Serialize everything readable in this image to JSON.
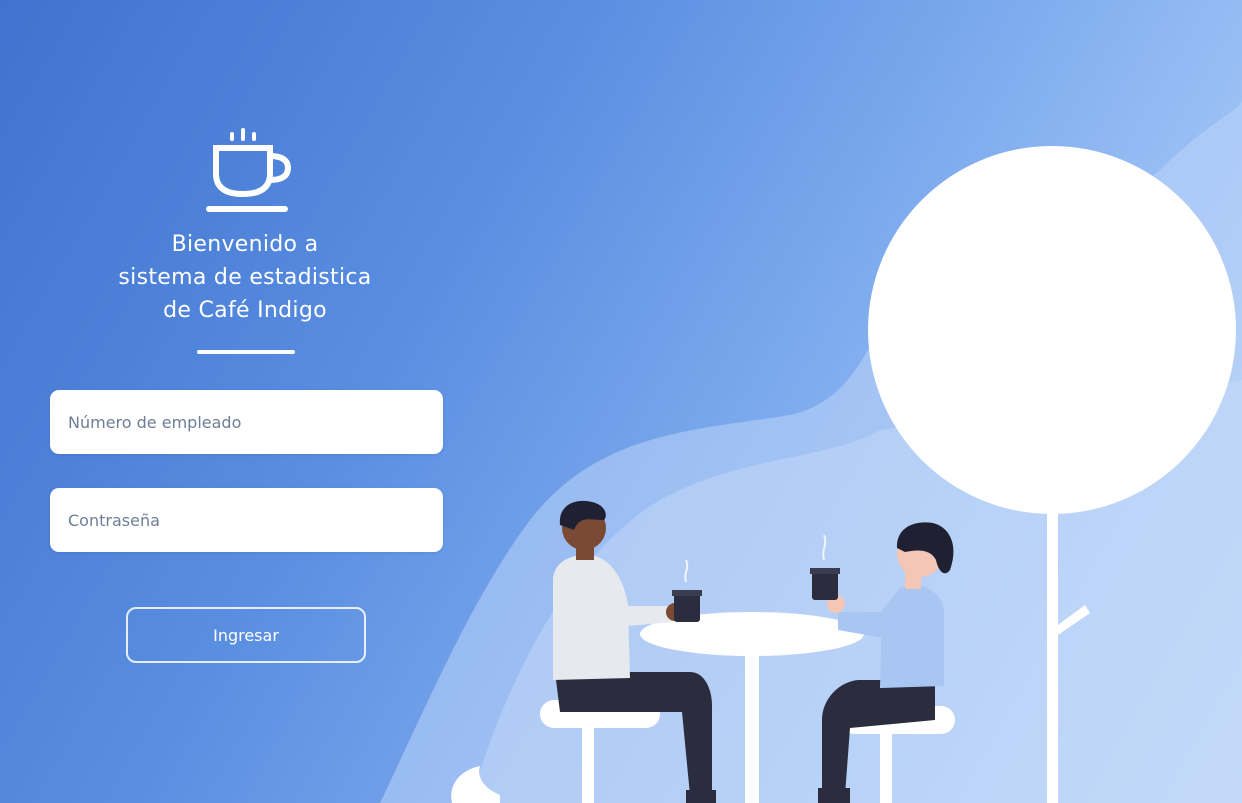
{
  "welcome": {
    "line1": "Bienvenido a",
    "line2": "sistema de estadistica",
    "line3": "de Café Indigo"
  },
  "form": {
    "employee_placeholder": "Número de empleado",
    "employee_value": "",
    "password_placeholder": "Contraseña",
    "password_value": "",
    "submit_label": "Ingresar"
  },
  "icons": {
    "logo": "coffee-cup-icon"
  },
  "colors": {
    "gradient_start": "#3f73cf",
    "gradient_end": "#c4dcfb",
    "white": "#ffffff",
    "trousers": "#2b2d3e",
    "shirt_left": "#e6e9ee",
    "shirt_right": "#a9c6f2",
    "skin_left": "#7a4a33",
    "skin_right": "#f3c6b5",
    "hair": "#1f2133"
  }
}
